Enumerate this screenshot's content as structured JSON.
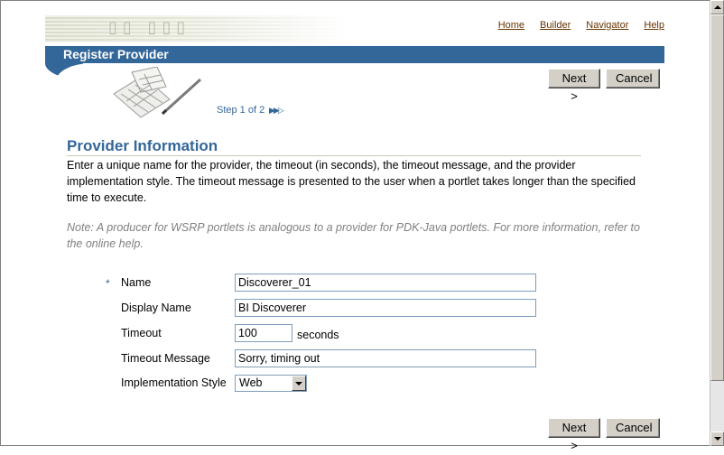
{
  "globalnav": [
    "Home",
    "Builder",
    "Navigator",
    "Help"
  ],
  "page": {
    "title": "Register Provider",
    "step": "Step 1 of 2"
  },
  "buttons": {
    "next": "Next >",
    "cancel": "Cancel"
  },
  "section": {
    "title": "Provider Information",
    "instructions": "Enter a unique name for the provider, the timeout (in seconds), the timeout message, and the provider implementation style. The timeout message is presented to the user when a portlet takes longer than the specified time to execute.",
    "note": "Note: A producer for WSRP portlets is analogous to a provider for PDK-Java portlets. For more information, refer to the online help."
  },
  "form": {
    "required_marker": "*",
    "name_label": "Name",
    "name_value": "Discoverer_01",
    "display_name_label": "Display Name",
    "display_name_value": "BI Discoverer",
    "timeout_label": "Timeout",
    "timeout_value": "100",
    "timeout_unit": "seconds",
    "timeout_message_label": "Timeout Message",
    "timeout_message_value": "Sorry, timing out",
    "implementation_style_label": "Implementation Style",
    "implementation_style_value": "Web"
  },
  "colors": {
    "brand_blue": "#336699",
    "link_brown": "#663300",
    "note_gray": "#808080"
  }
}
